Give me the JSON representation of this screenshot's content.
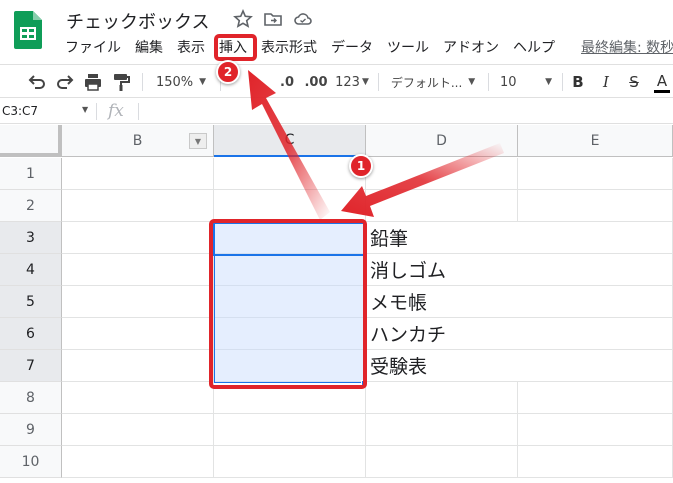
{
  "doc": {
    "title": "チェックボックス"
  },
  "menu": [
    {
      "label": "ファイル"
    },
    {
      "label": "編集"
    },
    {
      "label": "表示"
    },
    {
      "label": "挿入"
    },
    {
      "label": "表示形式"
    },
    {
      "label": "データ"
    },
    {
      "label": "ツール"
    },
    {
      "label": "アドオン"
    },
    {
      "label": "ヘルプ"
    }
  ],
  "last_edit": "最終編集: 数秒",
  "toolbar": {
    "zoom": "150%",
    "decimal_decrease": ".0",
    "decimal_increase": ".00",
    "number_format": "123",
    "font_family": "デフォルト...",
    "font_size": "10",
    "bold": "B",
    "italic": "I",
    "strikethrough": "S",
    "text_color": "A"
  },
  "formula_bar": {
    "name_box": "C3:C7",
    "fx": "fx"
  },
  "columns": [
    "B",
    "C",
    "D",
    "E"
  ],
  "rows": [
    "1",
    "2",
    "3",
    "4",
    "5",
    "6",
    "7",
    "8",
    "9",
    "10"
  ],
  "cells": {
    "D3": "鉛筆",
    "D4": "消しゴム",
    "D5": "メモ帳",
    "D6": "ハンカチ",
    "D7": "受験表"
  },
  "annotations": {
    "step1": "1",
    "step2": "2"
  },
  "colors": {
    "accent": "#1a73e8",
    "annotation": "#e0242a",
    "sheets_green": "#0f9d58"
  }
}
